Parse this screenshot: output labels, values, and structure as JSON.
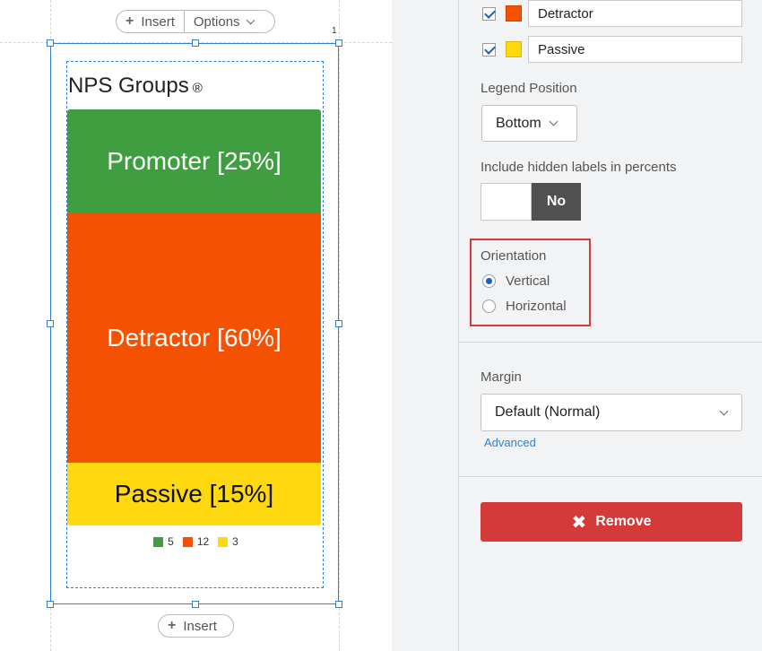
{
  "toolbar": {
    "insert_label": "Insert",
    "options_label": "Options",
    "bottom_insert_label": "Insert",
    "widget_index": "1"
  },
  "chart_data": {
    "type": "bar",
    "orientation": "vertical",
    "stacked": true,
    "title": "NPS Groups",
    "categories": [
      "Promoter",
      "Detractor",
      "Passive"
    ],
    "series": [
      {
        "name": "Promoter",
        "percent": 25,
        "count": 5,
        "color": "#3f9e40",
        "label": "Promoter [25%]"
      },
      {
        "name": "Detractor",
        "percent": 60,
        "count": 12,
        "color": "#f55102",
        "label": "Detractor [60%]"
      },
      {
        "name": "Passive",
        "percent": 15,
        "count": 3,
        "color": "#fed90f",
        "label": "Passive [15%]"
      }
    ],
    "legend_position": "bottom"
  },
  "legend": [
    {
      "value": "5",
      "color": "#3f9e40"
    },
    {
      "value": "12",
      "color": "#f55102"
    },
    {
      "value": "3",
      "color": "#fed90f"
    }
  ],
  "panel": {
    "series_rows": [
      {
        "name": "Detractor",
        "color": "#f55102",
        "checked": true
      },
      {
        "name": "Passive",
        "color": "#fed90f",
        "checked": true
      }
    ],
    "legend_position_label": "Legend Position",
    "legend_position_value": "Bottom",
    "hidden_labels_label": "Include hidden labels in percents",
    "hidden_labels_value": "No",
    "orientation_label": "Orientation",
    "orientation_options": [
      "Vertical",
      "Horizontal"
    ],
    "orientation_selected": "Vertical",
    "margin_label": "Margin",
    "margin_value": "Default (Normal)",
    "advanced_link": "Advanced",
    "remove_label": "Remove"
  }
}
